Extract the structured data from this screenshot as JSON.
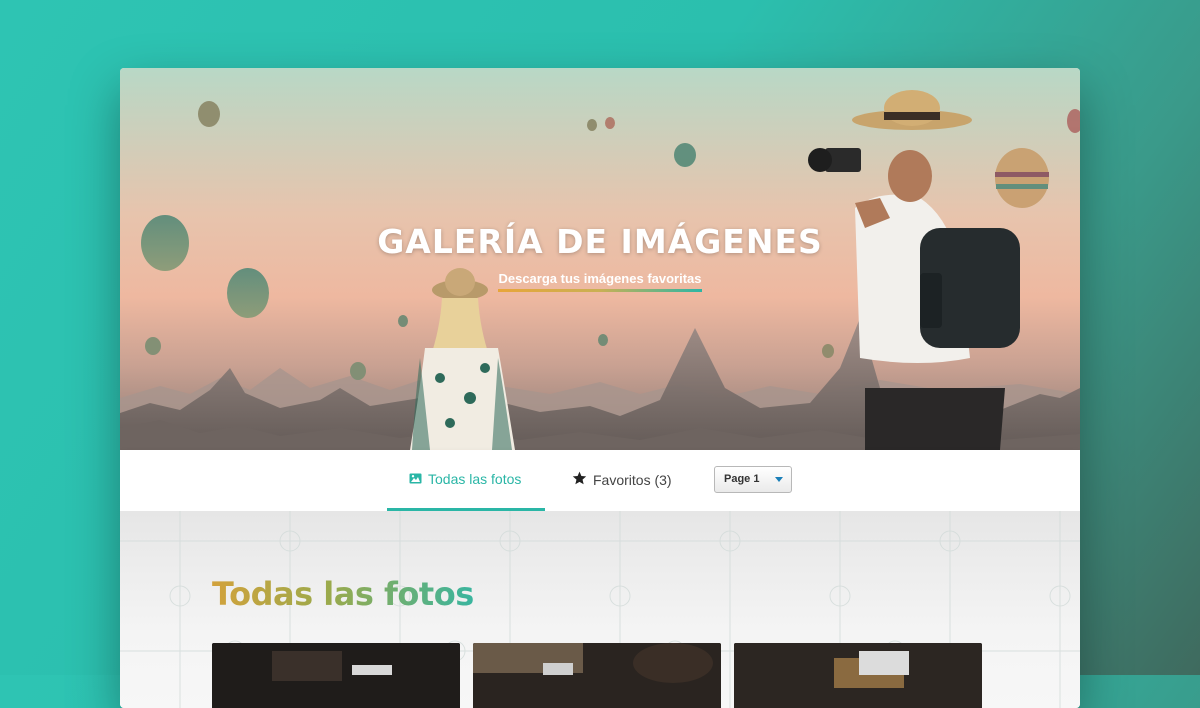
{
  "hero": {
    "title": "GALERÍA DE IMÁGENES",
    "subtitle": "Descarga tus imágenes favoritas"
  },
  "tabs": [
    {
      "label": "Todas las fotos",
      "icon": "image-icon",
      "active": true
    },
    {
      "label": "Favoritos (3)",
      "icon": "star-icon",
      "active": false
    }
  ],
  "page_select": {
    "value": "Page 1"
  },
  "section": {
    "title": "Todas las fotos"
  },
  "colors": {
    "accent": "#2ab6a6",
    "background": "#2ec4b3",
    "title_gradient_start": "#d2a23c",
    "title_gradient_end": "#39b59f"
  }
}
